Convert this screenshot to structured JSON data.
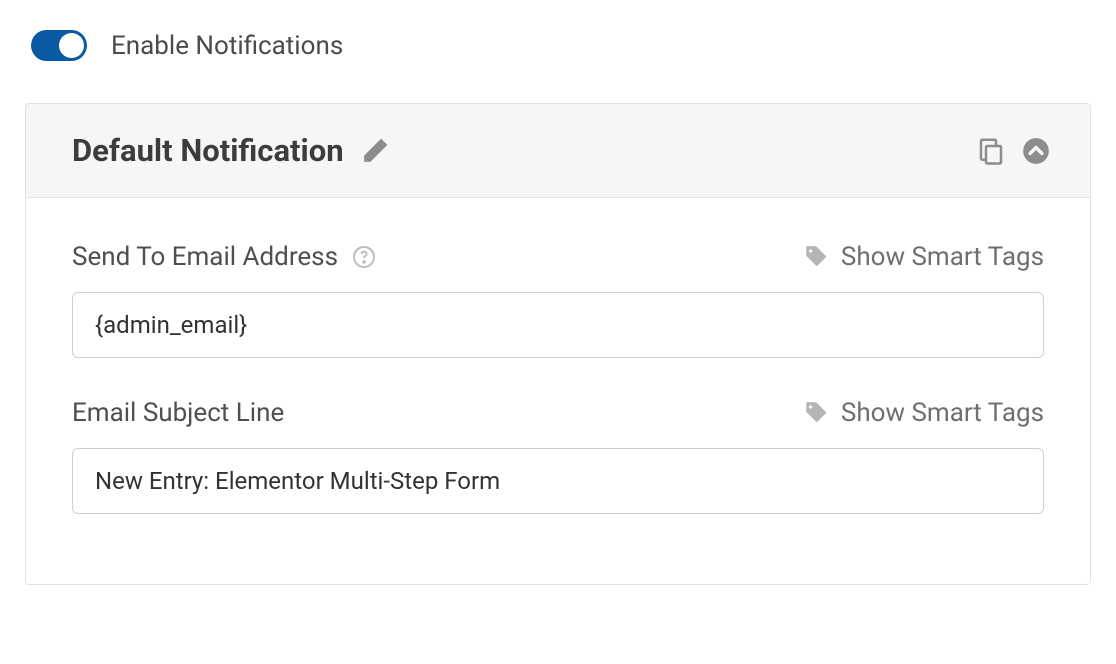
{
  "toggle": {
    "label": "Enable Notifications",
    "enabled": true
  },
  "panel": {
    "title": "Default Notification"
  },
  "fields": {
    "send_to": {
      "label": "Send To Email Address",
      "value": "{admin_email}",
      "smart_tags_label": "Show Smart Tags"
    },
    "subject": {
      "label": "Email Subject Line",
      "value": "New Entry: Elementor Multi-Step Form",
      "smart_tags_label": "Show Smart Tags"
    }
  }
}
